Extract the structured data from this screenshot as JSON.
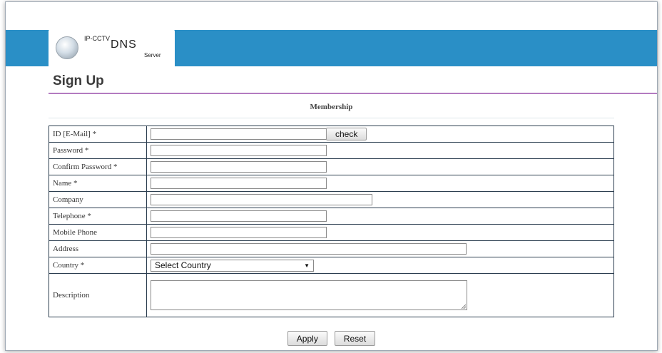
{
  "header": {
    "logo_ip_cctv": "IP-CCTV",
    "logo_dns": "DNS",
    "logo_server": "Server",
    "banner_color": "#2a8fc6"
  },
  "page": {
    "title": "Sign Up",
    "section_title": "Membership",
    "accent_color": "#b37bc0"
  },
  "form": {
    "id_label": "ID [E-Mail] *",
    "id_value": "",
    "check_button": "check",
    "password_label": "Password *",
    "password_value": "",
    "confirm_password_label": "Confirm Password *",
    "confirm_password_value": "",
    "name_label": "Name *",
    "name_value": "",
    "company_label": "Company",
    "company_value": "",
    "telephone_label": "Telephone *",
    "telephone_value": "",
    "mobile_label": "Mobile Phone",
    "mobile_value": "",
    "address_label": "Address",
    "address_value": "",
    "country_label": "Country *",
    "country_selected": "Select Country",
    "description_label": "Description",
    "description_value": ""
  },
  "actions": {
    "apply": "Apply",
    "reset": "Reset"
  }
}
